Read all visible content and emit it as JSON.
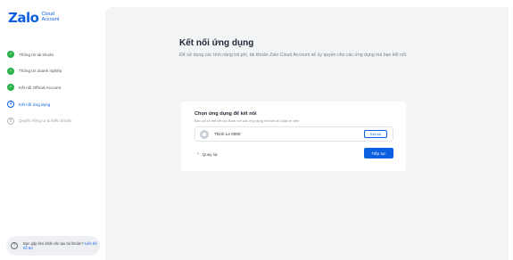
{
  "logo": {
    "brand": "Zalo",
    "sub_line1": "Cloud",
    "sub_line2": "Account"
  },
  "steps": [
    {
      "label": "Thông tin tài khoản",
      "state": "done",
      "icon": "check-icon"
    },
    {
      "label": "Thông tin doanh nghiệp",
      "state": "done",
      "icon": "check-icon"
    },
    {
      "label": "Kết nối Official Account",
      "state": "done",
      "icon": "check-icon"
    },
    {
      "label": "Kết nối ứng dụng",
      "state": "active",
      "number": "4"
    },
    {
      "label": "Quyền riêng tư & Điều khoản",
      "state": "todo",
      "number": "5"
    }
  ],
  "help": {
    "text": "Bạn gặp khó khăn khi tạo tài khoản?",
    "link": "Liên hệ hỗ trợ"
  },
  "main": {
    "title": "Kết nối ứng dụng",
    "description": "Để sử dụng các tính năng trả phí, tài khoản Zalo Cloud Account sẽ ủy quyền cho các ứng dụng mà bạn kết nối."
  },
  "card": {
    "title": "Chọn ứng dụng để kết nối",
    "subtitle": "Bạn chỉ có thể kết nối được với các ứng dụng mà bạn là Quản trị viên",
    "app_name": "Thịnh Le 0000",
    "connect_label": "Kết nối",
    "back_label": "Quay lại",
    "continue_label": "Tiếp tục"
  },
  "colors": {
    "accent": "#0b5fe0",
    "success": "#27b24a",
    "main_bg": "#f3f4f6"
  }
}
